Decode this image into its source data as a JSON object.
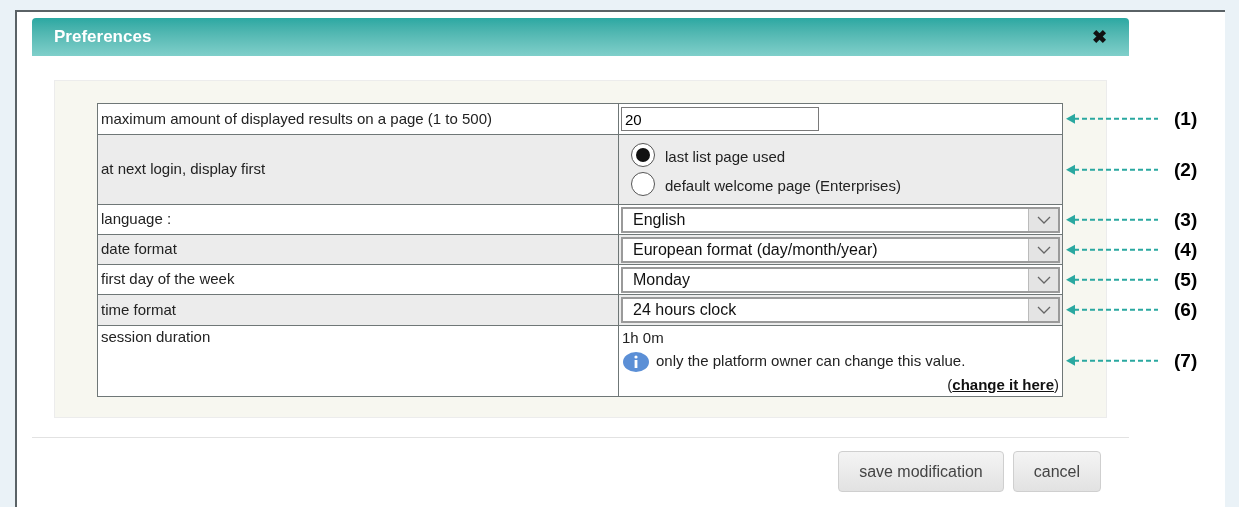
{
  "dialog": {
    "title": "Preferences",
    "close": "✖"
  },
  "rows": [
    {
      "kind": "text_input",
      "label": "maximum amount of displayed results on a page (1 to 500)",
      "value": "20",
      "callout": "(1)"
    },
    {
      "kind": "radio",
      "label": "at next login, display first",
      "options": [
        {
          "label": "last list page used",
          "selected": true
        },
        {
          "label": "default welcome page (Enterprises)",
          "selected": false
        }
      ],
      "callout": "(2)"
    },
    {
      "kind": "select",
      "label": "language :",
      "value": "English",
      "callout": "(3)"
    },
    {
      "kind": "select",
      "label": "date format",
      "value": "European format (day/month/year)",
      "callout": "(4)"
    },
    {
      "kind": "select",
      "label": "first day of the week",
      "value": "Monday",
      "callout": "(5)"
    },
    {
      "kind": "select",
      "label": "time format",
      "value": "24 hours clock",
      "callout": "(6)"
    },
    {
      "kind": "info",
      "label": "session duration",
      "value": "1h 0m",
      "note": "only the platform owner can change this value.",
      "link_open": "(",
      "link": "change it here",
      "link_close": ")",
      "callout": "(7)"
    }
  ],
  "buttons": [
    "save modification",
    "cancel"
  ]
}
